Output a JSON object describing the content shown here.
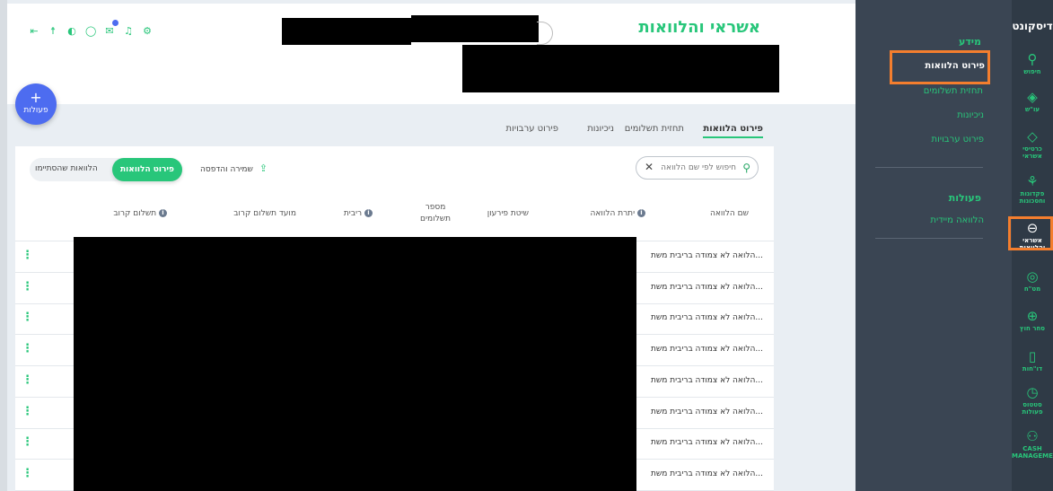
{
  "app": {
    "logo": "דיסקונט"
  },
  "rail": {
    "items": [
      {
        "icon": "search-icon",
        "glyph": "⚲",
        "label": "חיפוש"
      },
      {
        "icon": "current-account-icon",
        "glyph": "◈",
        "label": "עו\"ש"
      },
      {
        "icon": "credit-card-icon",
        "glyph": "◇",
        "label": "כרטיסי אשראי"
      },
      {
        "icon": "plant-icon",
        "glyph": "⚘",
        "label": "פקדונות וחסכונות"
      },
      {
        "icon": "loans-icon",
        "glyph": "⊖",
        "label": "אשראי והלוואות"
      },
      {
        "icon": "securities-icon",
        "glyph": "◎",
        "label": "מט\"ח"
      },
      {
        "icon": "globe-icon",
        "glyph": "⊕",
        "label": "סחר חוץ"
      },
      {
        "icon": "document-icon",
        "glyph": "▯",
        "label": "דו\"חות"
      },
      {
        "icon": "clock-icon",
        "glyph": "◷",
        "label": "סטטוס פעולות"
      },
      {
        "icon": "network-icon",
        "glyph": "⚇",
        "label": "CASH MANAGEMENT"
      }
    ]
  },
  "subnav": {
    "info_title": "מידע",
    "info_items": [
      "פירוט הלוואות",
      "תחזית תשלומים",
      "ניכיונות",
      "פירוט ערבויות"
    ],
    "actions_title": "פעולות",
    "action_items": [
      "הלוואה מיידית"
    ]
  },
  "header": {
    "title": "אשראי והלוואות",
    "icons": [
      "logout-icon",
      "accessibility-icon",
      "contrast-icon",
      "chat-icon",
      "mail-icon",
      "bell-icon",
      "gear-icon"
    ]
  },
  "fab": {
    "plus": "+",
    "label": "פעולות"
  },
  "tabs": [
    "פירוט הלוואות",
    "תחזית תשלומים",
    "ניכיונות",
    "פירוט ערבויות"
  ],
  "toolbar": {
    "search_placeholder": "חיפוש לפי שם הלוואה",
    "save_print": "שמירה והדפסה",
    "toggle_active": "פירוט הלוואות",
    "toggle_done": "הלוואות שהסתיימו"
  },
  "table": {
    "headers": {
      "name": "שם הלוואה",
      "balance": "יתרת הלוואה",
      "repayment": "שיטת פירעון",
      "num_payments_1": "מספר",
      "num_payments_2": "תשלומים",
      "interest": "ריבית",
      "next_date": "מועד תשלום קרוב",
      "next_payment": "תשלום קרוב"
    },
    "rows": [
      "הלואה לא צמודה בריבית משת...",
      "הלואה לא צמודה בריבית משת...",
      "הלואה לא צמודה בריבית משת...",
      "הלואה לא צמודה בריבית משת...",
      "הלואה לא צמודה בריבית משת...",
      "הלואה לא צמודה בריבית משת...",
      "הלואה לא צמודה בריבית משת...",
      "הלואה לא צמודה בריבית משת..."
    ]
  }
}
